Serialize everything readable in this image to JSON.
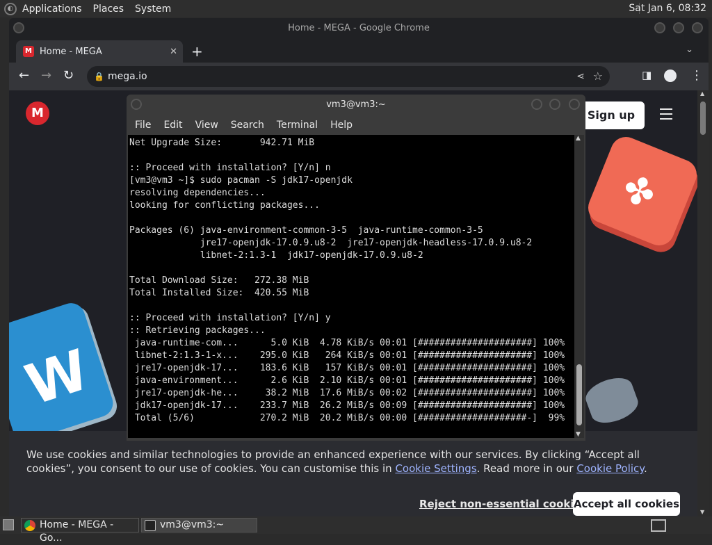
{
  "top_panel": {
    "menus": [
      "Applications",
      "Places",
      "System"
    ],
    "clock": "Sat Jan  6, 08:32"
  },
  "chrome": {
    "window_title": "Home - MEGA - Google Chrome",
    "tab_title": "Home - MEGA",
    "url": "mega.io"
  },
  "page": {
    "logo_letter": "M",
    "signup_label": "Sign up",
    "cookie": {
      "text_before": "We use cookies and similar technologies to provide an enhanced experience with our services. By clicking “Accept all cookies”, you consent to our use of cookies. You can customise this in ",
      "settings_link": "Cookie Settings",
      "text_mid": ". Read more in our ",
      "policy_link": "Cookie Policy",
      "text_after": ".",
      "reject_label": "Reject non-essential cookies",
      "accept_label": "Accept all cookies"
    }
  },
  "terminal": {
    "title": "vm3@vm3:~",
    "menus": [
      "File",
      "Edit",
      "View",
      "Search",
      "Terminal",
      "Help"
    ],
    "lines": [
      "Net Upgrade Size:       942.71 MiB",
      "",
      ":: Proceed with installation? [Y/n] n",
      "[vm3@vm3 ~]$ sudo pacman -S jdk17-openjdk",
      "resolving dependencies...",
      "looking for conflicting packages...",
      "",
      "Packages (6) java-environment-common-3-5  java-runtime-common-3-5",
      "             jre17-openjdk-17.0.9.u8-2  jre17-openjdk-headless-17.0.9.u8-2",
      "             libnet-2:1.3-1  jdk17-openjdk-17.0.9.u8-2",
      "",
      "Total Download Size:   272.38 MiB",
      "Total Installed Size:  420.55 MiB",
      "",
      ":: Proceed with installation? [Y/n] y",
      ":: Retrieving packages...",
      " java-runtime-com...      5.0 KiB  4.78 KiB/s 00:01 [#####################] 100%",
      " libnet-2:1.3-1-x...    295.0 KiB   264 KiB/s 00:01 [#####################] 100%",
      " jre17-openjdk-17...    183.6 KiB   157 KiB/s 00:01 [#####################] 100%",
      " java-environment...      2.6 KiB  2.10 KiB/s 00:01 [#####################] 100%",
      " jre17-openjdk-he...     38.2 MiB  17.6 MiB/s 00:02 [#####################] 100%",
      " jdk17-openjdk-17...    233.7 MiB  26.2 MiB/s 00:09 [#####################] 100%",
      " Total (5/6)            270.2 MiB  20.2 MiB/s 00:00 [####################-]  99%"
    ]
  },
  "taskbar": {
    "tasks": [
      "Home - MEGA - Go...",
      "vm3@vm3:~"
    ]
  },
  "colors": {
    "mega_red": "#d9272e",
    "chrome_dark": "#202124",
    "terminal_bg": "#000000"
  }
}
